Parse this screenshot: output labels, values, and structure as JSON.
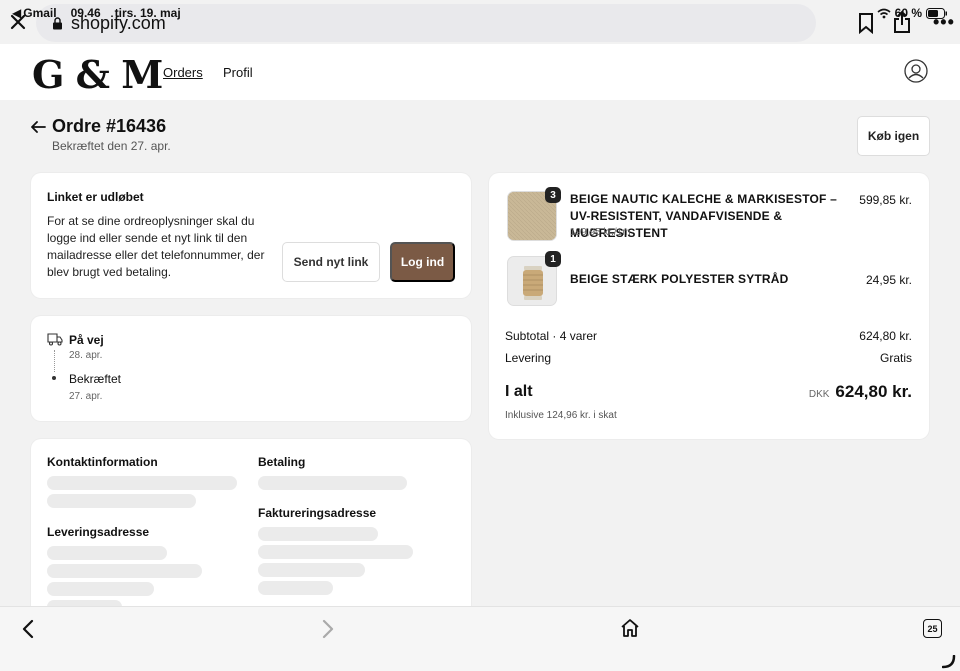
{
  "status": {
    "app_back": "Gmail",
    "time": "09.46",
    "date": "tirs. 19. maj",
    "battery": "60 %"
  },
  "browser": {
    "url": "shopify.com",
    "tabs_count": "25"
  },
  "store": {
    "logo": "G & M",
    "nav": {
      "orders": "Orders",
      "profile": "Profil"
    }
  },
  "order": {
    "title": "Ordre #16436",
    "confirmed": "Bekræftet den 27. apr.",
    "buy_again": "Køb igen"
  },
  "link_card": {
    "heading": "Linket er udløbet",
    "body": "For at se dine ordreoplysninger skal du logge ind eller sende et nyt link til den mailadresse eller det telefonnummer, der blev brugt ved betaling.",
    "send_button": "Send nyt link",
    "login_button": "Log ind",
    "login_color": "#7b5a45"
  },
  "tracking": {
    "steps": [
      {
        "label": "På vej",
        "date": "28. apr."
      },
      {
        "label": "Bekræftet",
        "date": "27. apr."
      }
    ]
  },
  "info": {
    "contact": "Kontaktinformation",
    "payment": "Betaling",
    "shipping_address": "Leveringsadresse",
    "billing_address": "Faktureringsadresse"
  },
  "summary": {
    "items": [
      {
        "name": "BEIGE NAUTIC KALECHE & MARKISESTOF – UV-RESISTENT, VANDAFVISENDE & MUGRESISTENT",
        "unit_price": "199,95 kr./1m",
        "price": "599,85 kr.",
        "qty": "3"
      },
      {
        "name": "BEIGE STÆRK POLYESTER SYTRÅD",
        "price": "24,95 kr.",
        "qty": "1"
      }
    ],
    "subtotal_label": "Subtotal · 4 varer",
    "subtotal_value": "624,80 kr.",
    "shipping_label": "Levering",
    "shipping_value": "Gratis",
    "total_label": "I alt",
    "currency": "DKK",
    "total_value": "624,80 kr.",
    "tax_note": "Inklusive 124,96 kr. i skat"
  }
}
